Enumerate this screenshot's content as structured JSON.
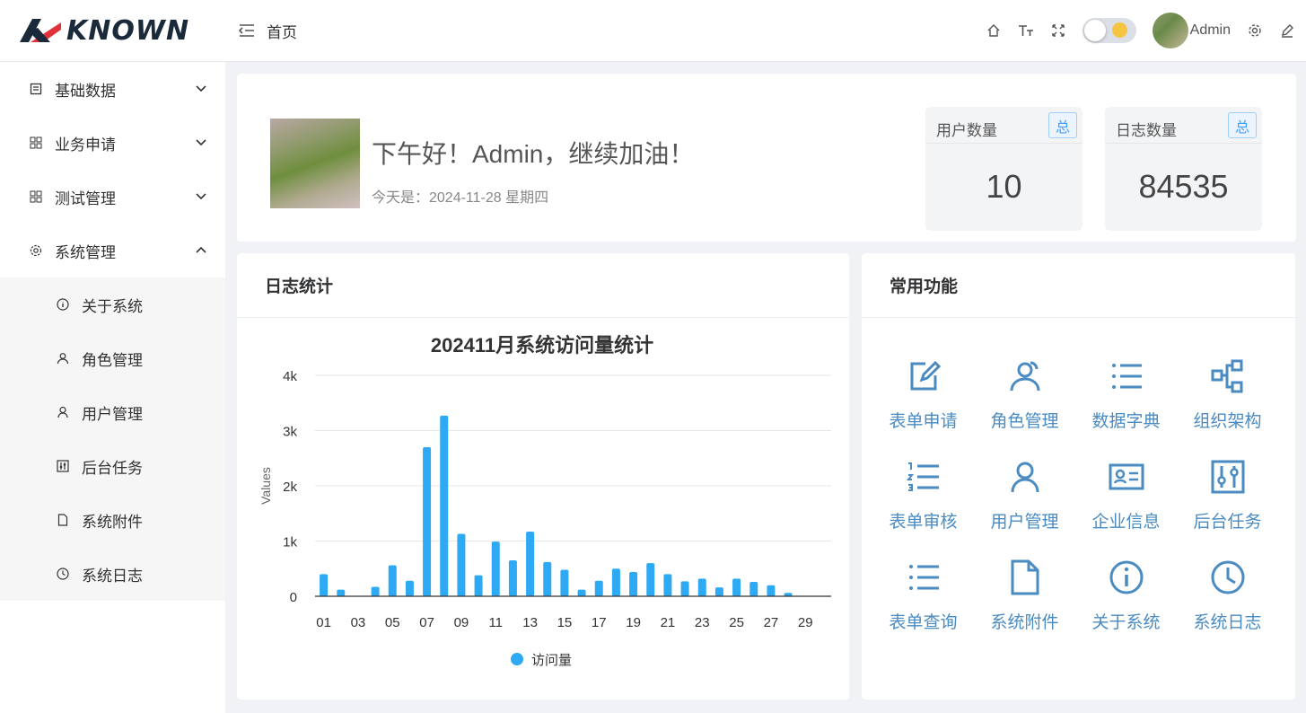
{
  "header": {
    "logo_text": "KNOWN",
    "breadcrumb": "首页",
    "user_name": "Admin"
  },
  "sidebar": {
    "items": [
      {
        "label": "基础数据",
        "icon": "list-icon"
      },
      {
        "label": "业务申请",
        "icon": "grid-icon"
      },
      {
        "label": "测试管理",
        "icon": "grid-icon"
      },
      {
        "label": "系统管理",
        "icon": "gear-icon"
      }
    ],
    "sub_items": [
      {
        "label": "关于系统",
        "icon": "info-icon"
      },
      {
        "label": "角色管理",
        "icon": "users-icon"
      },
      {
        "label": "用户管理",
        "icon": "user-icon"
      },
      {
        "label": "后台任务",
        "icon": "sliders-icon"
      },
      {
        "label": "系统附件",
        "icon": "document-icon"
      },
      {
        "label": "系统日志",
        "icon": "clock-icon"
      }
    ]
  },
  "welcome": {
    "greeting": "下午好！Admin，继续加油！",
    "date": "今天是：2024-11-28 星期四"
  },
  "stats": [
    {
      "label": "用户数量",
      "tag": "总",
      "value": "10"
    },
    {
      "label": "日志数量",
      "tag": "总",
      "value": "84535"
    }
  ],
  "log_card": {
    "title": "日志统计"
  },
  "func_card": {
    "title": "常用功能",
    "items": [
      {
        "label": "表单申请",
        "icon": "edit-icon"
      },
      {
        "label": "角色管理",
        "icon": "users-icon"
      },
      {
        "label": "数据字典",
        "icon": "list-icon"
      },
      {
        "label": "组织架构",
        "icon": "org-icon"
      },
      {
        "label": "表单审核",
        "icon": "ordered-list-icon"
      },
      {
        "label": "用户管理",
        "icon": "user-icon"
      },
      {
        "label": "企业信息",
        "icon": "id-card-icon"
      },
      {
        "label": "后台任务",
        "icon": "sliders-icon"
      },
      {
        "label": "表单查询",
        "icon": "list-icon"
      },
      {
        "label": "系统附件",
        "icon": "document-icon"
      },
      {
        "label": "关于系统",
        "icon": "info-icon"
      },
      {
        "label": "系统日志",
        "icon": "clock-icon"
      }
    ]
  },
  "chart_data": {
    "type": "bar",
    "title": "202411月系统访问量统计",
    "ylabel": "Values",
    "ylim": [
      0,
      4000
    ],
    "yticks": [
      "0",
      "1k",
      "2k",
      "3k",
      "4k"
    ],
    "categories": [
      "01",
      "02",
      "03",
      "04",
      "05",
      "06",
      "07",
      "08",
      "09",
      "10",
      "11",
      "12",
      "13",
      "14",
      "15",
      "16",
      "17",
      "18",
      "19",
      "20",
      "21",
      "22",
      "23",
      "24",
      "25",
      "26",
      "27",
      "28",
      "29",
      "30"
    ],
    "xtick_labels": [
      "01",
      "03",
      "05",
      "07",
      "09",
      "11",
      "13",
      "15",
      "17",
      "19",
      "21",
      "23",
      "25",
      "27",
      "29"
    ],
    "series": [
      {
        "name": "访问量",
        "color": "#2eaaf5",
        "values": [
          400,
          120,
          0,
          170,
          560,
          280,
          2700,
          3270,
          1130,
          380,
          990,
          650,
          1170,
          620,
          480,
          120,
          280,
          500,
          440,
          600,
          400,
          270,
          320,
          160,
          320,
          260,
          200,
          60,
          0,
          0
        ]
      }
    ],
    "legend": "bottom-center"
  }
}
